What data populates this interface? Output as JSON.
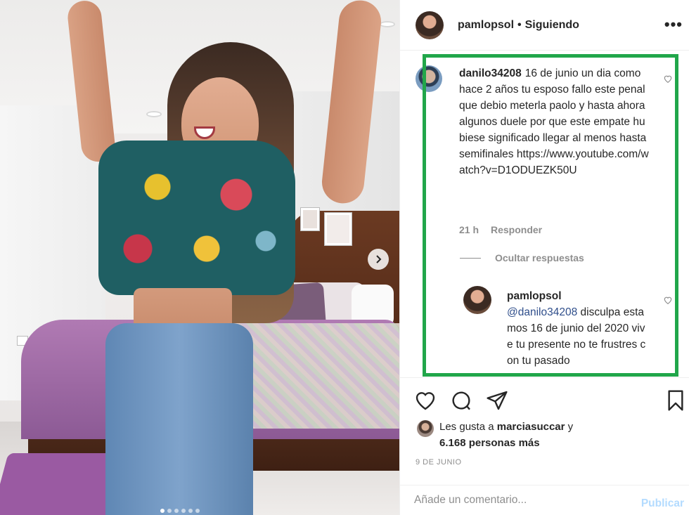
{
  "header": {
    "username": "pamlopsol",
    "separator": "•",
    "follow_status": "Siguiendo",
    "more_icon": "more-horizontal-icon"
  },
  "photo": {
    "carousel_dots": 6,
    "active_dot": 0
  },
  "comments": [
    {
      "username": "danilo34208",
      "text": "16 de junio un dia como hace 2 años tu esposo fallo este penal que debio meterla paolo y hasta ahora algunos duele por que este empate hubiese significado llegar al menos hasta semifinales https://www.youtube.com/watch?v=D1ODUEZK50U",
      "time": "21 h",
      "reply_label": "Responder",
      "hide_replies_label": "Ocultar respuestas",
      "replies": [
        {
          "username": "pamlopsol",
          "mention": "@danilo34208",
          "text": "disculpa estamos 16 de junio del 2020 vive tu presente no te frustres con tu pasado"
        }
      ]
    }
  ],
  "likes": {
    "prefix": "Les gusta a",
    "user": "marciasuccar",
    "connector": "y",
    "count_text": "6.168 personas más"
  },
  "date": "9 DE JUNIO",
  "add_comment": {
    "placeholder": "Añade un comentario...",
    "publish_label": "Publicar"
  },
  "colors": {
    "highlight_box": "#21a64a",
    "publish_disabled": "#b3dbff",
    "mention": "#2f4e8b"
  }
}
